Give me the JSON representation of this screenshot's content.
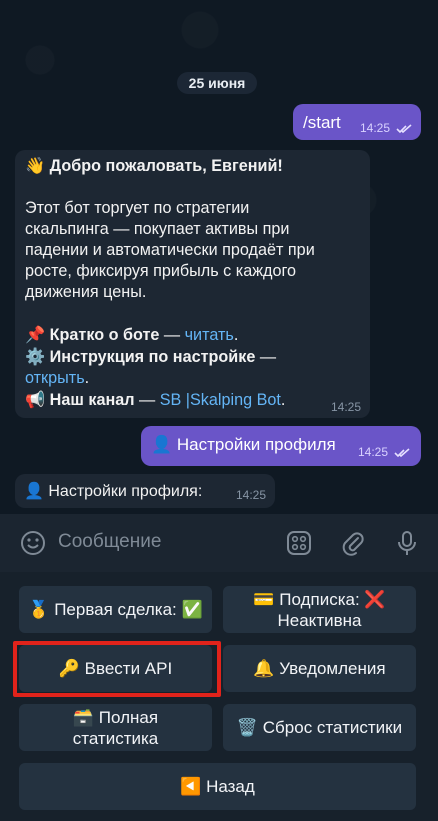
{
  "chat": {
    "date": "25 июня",
    "start_msg": {
      "text": "/start",
      "time": "14:25"
    },
    "welcome_msg": {
      "greeting": "👋 Добро пожаловать, Евгений!",
      "line1": "Этот бот торгует по стратегии",
      "line2": "скальпинга — покупает активы при",
      "line3": "падении и автоматически продаёт при",
      "line4": "росте, фиксируя прибыль с каждого",
      "line5": "движения цены.",
      "about_icon": "📌",
      "about_label": "Кратко о боте",
      "about_dash": " — ",
      "about_link": "читать",
      "instr_icon": "⚙️",
      "instr_label": "Инструкция по настройке",
      "instr_dash": " —",
      "instr_link": "открыть",
      "channel_icon": "📢",
      "channel_label": "Наш канал",
      "channel_dash": " — ",
      "channel_link": "SB |Skalping Bot",
      "time": "14:25"
    },
    "settings_out": {
      "text": "👤 Настройки профиля",
      "time": "14:25"
    },
    "settings_in": {
      "text": "👤 Настройки профиля:",
      "time": "14:25"
    }
  },
  "input": {
    "placeholder": "Сообщение",
    "emoji_icon": "emoji-icon",
    "sticker_icon": "sticker-icon",
    "attach_icon": "paperclip-icon",
    "mic_icon": "microphone-icon"
  },
  "keyboard": {
    "first_trade": "🥇 Первая сделка: ✅",
    "subscription_line1": "💳 Подписка: ❌",
    "subscription_line2": "Неактивна",
    "enter_api": "🔑 Ввести API",
    "notifications": "🔔 Уведомления",
    "full_stats_line1": "🗃️ Полная",
    "full_stats_line2": "статистика",
    "reset_stats": "🗑️ Сброс статистики",
    "back": "◀️ Назад"
  },
  "colors": {
    "outgoing_bubble": "#6a55c8",
    "incoming_bubble": "#1d2733",
    "link": "#64b5f6",
    "highlight_border": "#e1231b"
  }
}
